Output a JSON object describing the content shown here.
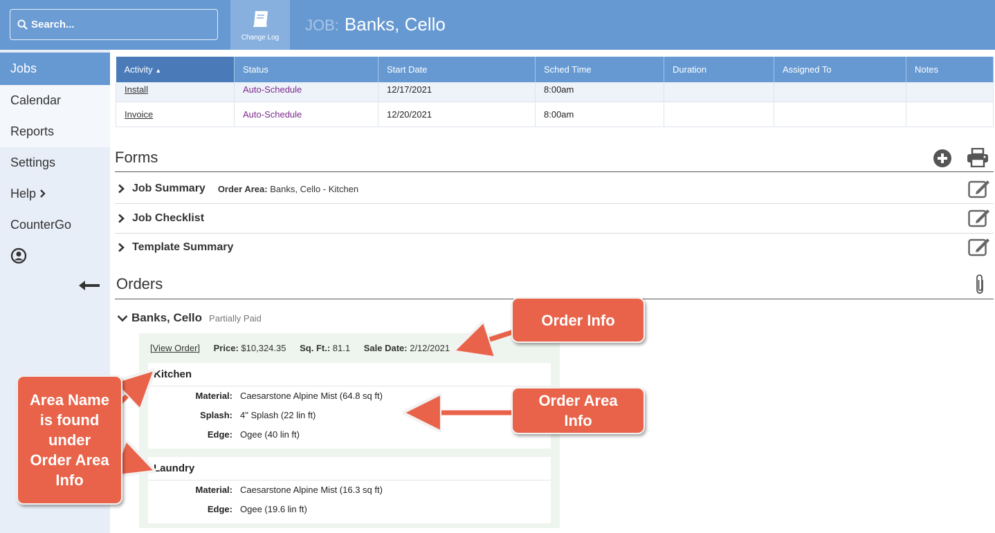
{
  "header": {
    "search_placeholder": "Search...",
    "changelog_label": "Change Log",
    "job_prefix": "JOB:",
    "job_name": "Banks, Cello"
  },
  "sidebar": {
    "items": [
      {
        "label": "Jobs"
      },
      {
        "label": "Calendar"
      },
      {
        "label": "Reports"
      },
      {
        "label": "Settings"
      },
      {
        "label": "Help"
      },
      {
        "label": "CounterGo"
      }
    ]
  },
  "activities": {
    "columns": [
      "Activity",
      "Status",
      "Start Date",
      "Sched Time",
      "Duration",
      "Assigned To",
      "Notes"
    ],
    "rows": [
      {
        "activity": "Install",
        "status": "Auto-Schedule",
        "start": "12/17/2021",
        "time": "8:00am",
        "duration": "",
        "assigned": "",
        "notes": ""
      },
      {
        "activity": "Invoice",
        "status": "Auto-Schedule",
        "start": "12/20/2021",
        "time": "8:00am",
        "duration": "",
        "assigned": "",
        "notes": ""
      }
    ]
  },
  "forms": {
    "title": "Forms",
    "items": [
      {
        "label": "Job Summary",
        "meta_key": "Order Area:",
        "meta_value": "Banks, Cello - Kitchen"
      },
      {
        "label": "Job Checklist"
      },
      {
        "label": "Template Summary"
      }
    ]
  },
  "orders": {
    "title": "Orders",
    "order_name": "Banks, Cello",
    "payment_status": "Partially Paid",
    "view_order": "[View Order]",
    "price_label": "Price:",
    "price": "$10,324.35",
    "sqft_label": "Sq. Ft.:",
    "sqft": "81.1",
    "sale_date_label": "Sale Date:",
    "sale_date": "2/12/2021",
    "areas": [
      {
        "name": "Kitchen",
        "rows": [
          {
            "k": "Material:",
            "v": "Caesarstone Alpine Mist (64.8 sq ft)"
          },
          {
            "k": "Splash:",
            "v": "4\" Splash (22 lin ft)"
          },
          {
            "k": "Edge:",
            "v": "Ogee (40 lin ft)"
          }
        ]
      },
      {
        "name": "Laundry",
        "rows": [
          {
            "k": "Material:",
            "v": "Caesarstone Alpine Mist (16.3 sq ft)"
          },
          {
            "k": "Edge:",
            "v": "Ogee (19.6 lin ft)"
          }
        ]
      }
    ]
  },
  "callouts": {
    "order_info": "Order Info",
    "order_area_info_1": "Order Area",
    "order_area_info_2": "Info",
    "area_name_1": "Area Name",
    "area_name_2": "is found",
    "area_name_3": "under",
    "area_name_4": "Order Area",
    "area_name_5": "Info"
  },
  "colors": {
    "header_blue": "#6699d2",
    "callout_red": "#e8634a",
    "status_purple": "#7a2a8a"
  }
}
